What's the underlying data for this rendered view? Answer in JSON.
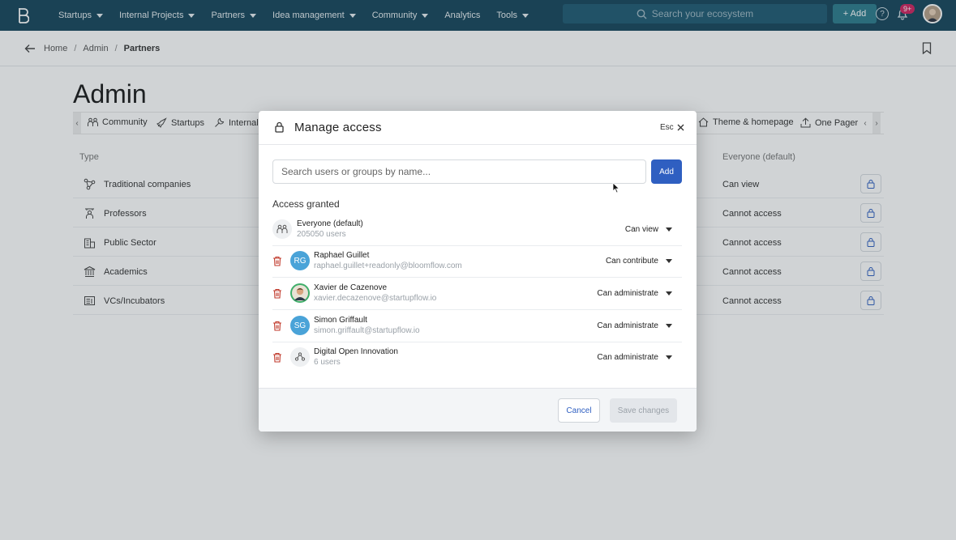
{
  "nav": {
    "items": [
      {
        "label": "Startups",
        "caret": true
      },
      {
        "label": "Internal Projects",
        "caret": true
      },
      {
        "label": "Partners",
        "caret": true
      },
      {
        "label": "Idea management",
        "caret": true
      },
      {
        "label": "Community",
        "caret": true
      },
      {
        "label": "Analytics",
        "caret": false
      },
      {
        "label": "Tools",
        "caret": true
      }
    ],
    "search_placeholder": "Search your ecosystem",
    "add_label": "+ Add",
    "help_label": "?",
    "notification_badge": "9+"
  },
  "breadcrumb": {
    "items": [
      "Home",
      "Admin",
      "Partners"
    ],
    "separator": "/"
  },
  "page": {
    "title": "Admin",
    "tabs": [
      "Community",
      "Startups",
      "Internal",
      "Theme & homepage",
      "One Pager"
    ],
    "tab_prev": "‹",
    "tab_next": "›",
    "table": {
      "col_type": "Type",
      "col_everyone": "Everyone (default)",
      "rows": [
        {
          "label": "Traditional companies",
          "access": "Can view",
          "icon": "network-icon"
        },
        {
          "label": "Professors",
          "access": "Cannot access",
          "icon": "professor-icon"
        },
        {
          "label": "Public Sector",
          "access": "Cannot access",
          "icon": "building-icon"
        },
        {
          "label": "Academics",
          "access": "Cannot access",
          "icon": "institution-icon"
        },
        {
          "label": "VCs/Incubators",
          "access": "Cannot access",
          "icon": "vc-icon"
        }
      ]
    }
  },
  "modal": {
    "title": "Manage access",
    "esc_label": "Esc",
    "search_placeholder": "Search users or groups by name...",
    "add_label": "Add",
    "access_title": "Access granted",
    "entries": [
      {
        "name": "Everyone (default)",
        "sub": "205050 users",
        "permission": "Can view",
        "avatar": "",
        "avatar_color": "#eef0f2",
        "removable": false
      },
      {
        "name": "Raphael Guillet",
        "sub": "raphael.guillet+readonly@bloomflow.com",
        "permission": "Can contribute",
        "avatar": "RG",
        "avatar_color": "#4aa3d8",
        "removable": true
      },
      {
        "name": "Xavier de Cazenove",
        "sub": "xavier.decazenove@startupflow.io",
        "permission": "Can administrate",
        "avatar": "",
        "avatar_color": "#3fae6a",
        "removable": true
      },
      {
        "name": "Simon Griffault",
        "sub": "simon.griffault@startupflow.io",
        "permission": "Can administrate",
        "avatar": "SG",
        "avatar_color": "#4aa3d8",
        "removable": true
      },
      {
        "name": "Digital Open Innovation",
        "sub": "6 users",
        "permission": "Can administrate",
        "avatar": "",
        "avatar_color": "#eef0f2",
        "removable": true
      }
    ],
    "cancel_label": "Cancel",
    "save_label": "Save changes"
  },
  "colors": {
    "nav_bg": "#16465b",
    "primary": "#2f5fc1",
    "danger": "#c0392b"
  }
}
